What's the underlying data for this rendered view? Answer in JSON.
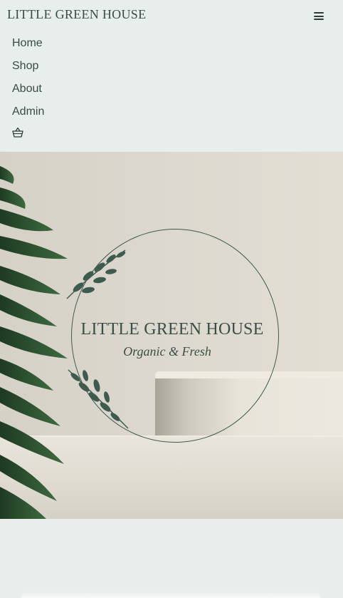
{
  "header": {
    "brand": "LITTLE GREEN HOUSE",
    "menu_icon": "hamburger-icon"
  },
  "nav": {
    "items": [
      {
        "label": "Home"
      },
      {
        "label": "Shop"
      },
      {
        "label": "About"
      },
      {
        "label": "Admin"
      }
    ],
    "cart_icon": "basket-icon"
  },
  "hero": {
    "logo": {
      "title": "LITTLE GREEN HOUSE",
      "tagline": "Organic  & Fresh"
    },
    "colors": {
      "logo_green": "#3b4f47",
      "leaf_green": "#2c4a30",
      "background": "#e8eeec"
    }
  }
}
